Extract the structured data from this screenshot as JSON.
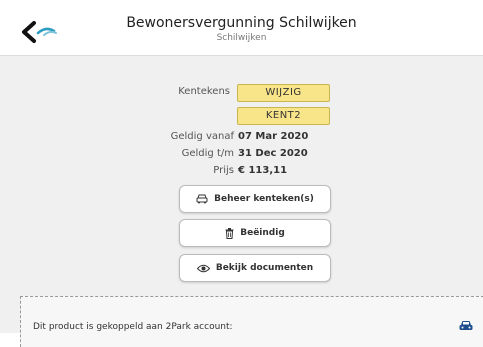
{
  "header": {
    "title": "Bewonersvergunning Schilwijken",
    "subtitle": "Schilwijken"
  },
  "details": {
    "kentekens_label": "Kentekens",
    "plates": [
      "WIJZIG",
      "KENT2"
    ],
    "geldig_vanaf_label": "Geldig vanaf",
    "geldig_vanaf_value": "07 Mar 2020",
    "geldig_tm_label": "Geldig t/m",
    "geldig_tm_value": "31 Dec 2020",
    "prijs_label": "Prijs",
    "prijs_value": "€ 113,11"
  },
  "actions": {
    "beheer_label": "Beheer kenteken(s)",
    "beeindig_label": "Beëindig",
    "documenten_label": "Bekijk documenten"
  },
  "linked": {
    "text": "Dit product is gekoppeld aan 2Park account:"
  },
  "colors": {
    "plate_bg": "#f8e58a",
    "accent_blue": "#1e4f8c",
    "back_teal": "#2a9cc0"
  },
  "icons": {
    "back": "chevron-left-icon",
    "brand": "swoosh-logo-icon",
    "car": "car-icon",
    "trash": "trash-icon",
    "eye": "eye-icon"
  }
}
